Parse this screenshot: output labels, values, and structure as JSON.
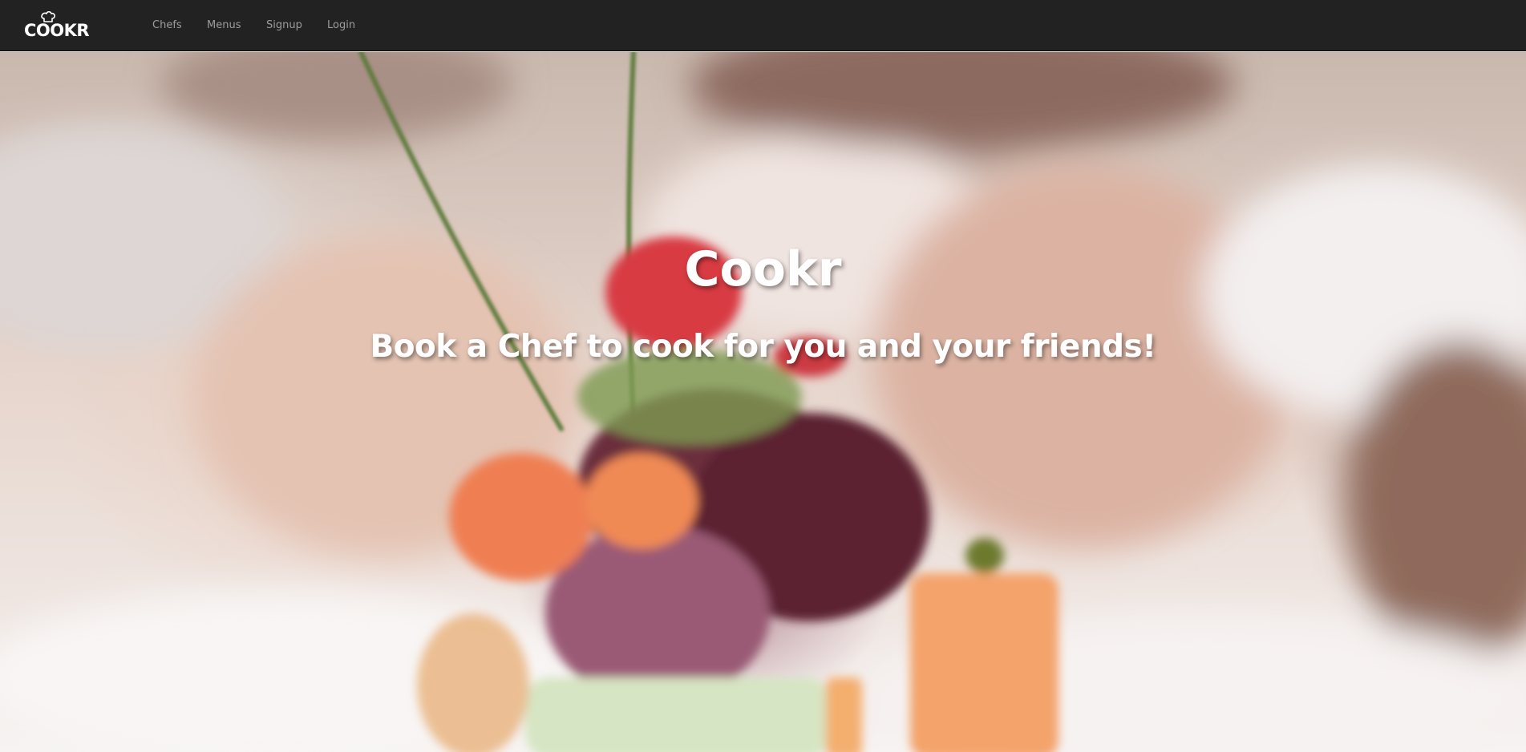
{
  "navbar": {
    "brand": "COOKR",
    "brand_icon": "chef-hat-icon",
    "links": [
      {
        "label": "Chefs"
      },
      {
        "label": "Menus"
      },
      {
        "label": "Signup"
      },
      {
        "label": "Login"
      }
    ],
    "background_color": "#222222",
    "link_color": "#9d9d9d"
  },
  "hero": {
    "title": "Cookr",
    "subtitle": "Book a Chef to cook for you and your friends!",
    "image": "plated-salad-with-edible-flowers-photo"
  }
}
